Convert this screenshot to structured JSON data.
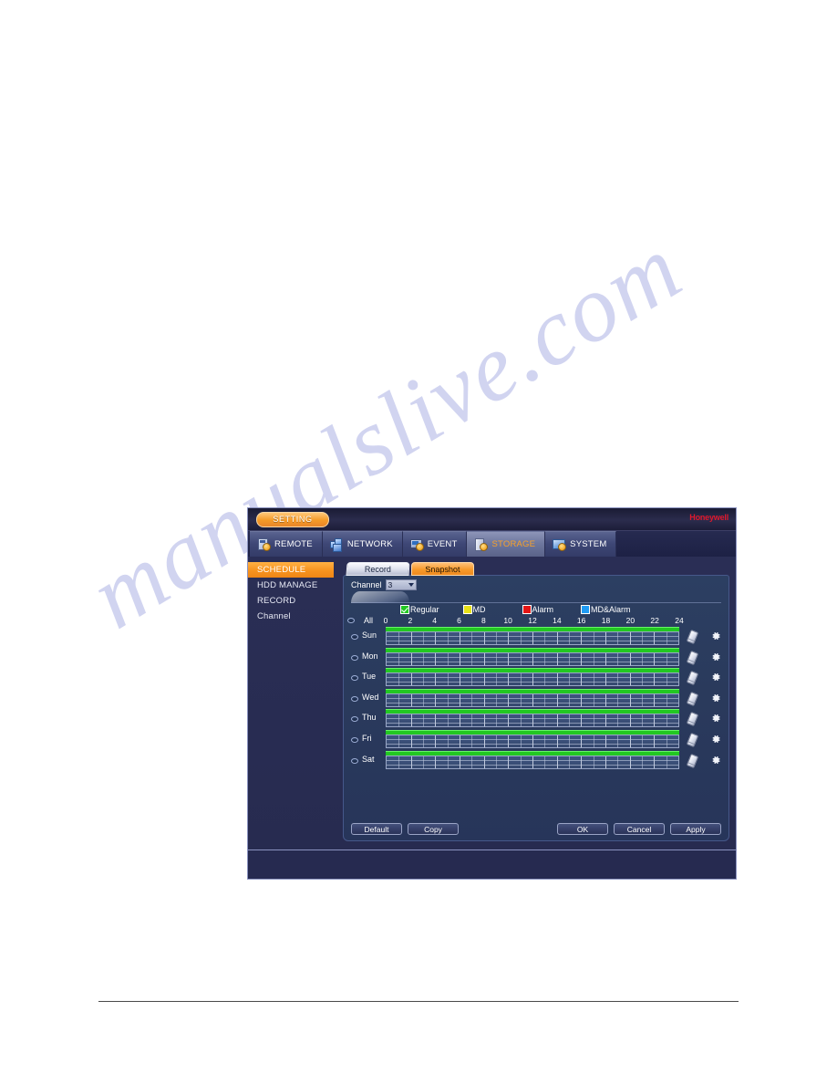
{
  "page": {
    "watermark_text": "manualslive.com"
  },
  "window": {
    "title_badge": "SETTING",
    "brand": "Honeywell"
  },
  "nav": {
    "tabs": [
      {
        "label": "REMOTE",
        "icon": "remote-icon",
        "active": false
      },
      {
        "label": "NETWORK",
        "icon": "network-icon",
        "active": false
      },
      {
        "label": "EVENT",
        "icon": "event-icon",
        "active": false
      },
      {
        "label": "STORAGE",
        "icon": "storage-icon",
        "active": true
      },
      {
        "label": "SYSTEM",
        "icon": "system-icon",
        "active": false
      }
    ]
  },
  "sidebar": {
    "items": [
      {
        "label": "SCHEDULE",
        "active": true
      },
      {
        "label": "HDD MANAGE",
        "active": false
      },
      {
        "label": "RECORD",
        "active": false
      },
      {
        "label": "Channel",
        "active": false
      }
    ]
  },
  "subtabs": [
    {
      "label": "Record",
      "active": false
    },
    {
      "label": "Snapshot",
      "active": true
    }
  ],
  "channel": {
    "label": "Channel",
    "value": "3"
  },
  "legend": [
    {
      "label": "Regular",
      "color": "#22c722",
      "checked": true
    },
    {
      "label": "MD",
      "color": "#e8e017",
      "checked": false
    },
    {
      "label": "Alarm",
      "color": "#e51515",
      "checked": false
    },
    {
      "label": "MD&Alarm",
      "color": "#1f9bf5",
      "checked": false
    }
  ],
  "schedule": {
    "all_label": "All",
    "hour_ticks": [
      0,
      2,
      4,
      6,
      8,
      10,
      12,
      14,
      16,
      18,
      20,
      22,
      24
    ],
    "hours_min": 0,
    "hours_max": 24,
    "row_tools": {
      "eraser": "eraser-icon",
      "settings": "gear-icon"
    },
    "rows": [
      {
        "day": "Sun",
        "periods": [
          {
            "start": 0,
            "end": 24,
            "type": "Regular"
          }
        ]
      },
      {
        "day": "Mon",
        "periods": [
          {
            "start": 0,
            "end": 24,
            "type": "Regular"
          }
        ]
      },
      {
        "day": "Tue",
        "periods": [
          {
            "start": 0,
            "end": 24,
            "type": "Regular"
          }
        ]
      },
      {
        "day": "Wed",
        "periods": [
          {
            "start": 0,
            "end": 24,
            "type": "Regular"
          }
        ]
      },
      {
        "day": "Thu",
        "periods": [
          {
            "start": 0,
            "end": 24,
            "type": "Regular"
          }
        ]
      },
      {
        "day": "Fri",
        "periods": [
          {
            "start": 0,
            "end": 24,
            "type": "Regular"
          }
        ]
      },
      {
        "day": "Sat",
        "periods": [
          {
            "start": 0,
            "end": 24,
            "type": "Regular"
          }
        ]
      }
    ]
  },
  "buttons": {
    "left": [
      {
        "label": "Default"
      },
      {
        "label": "Copy"
      }
    ],
    "right": [
      {
        "label": "OK"
      },
      {
        "label": "Cancel"
      },
      {
        "label": "Apply"
      }
    ]
  },
  "colors": {
    "accent_orange": "#f7931e",
    "active_green": "#1ee01e",
    "brand_red": "#e0182d",
    "panel_blue": "#2a3a5c"
  }
}
